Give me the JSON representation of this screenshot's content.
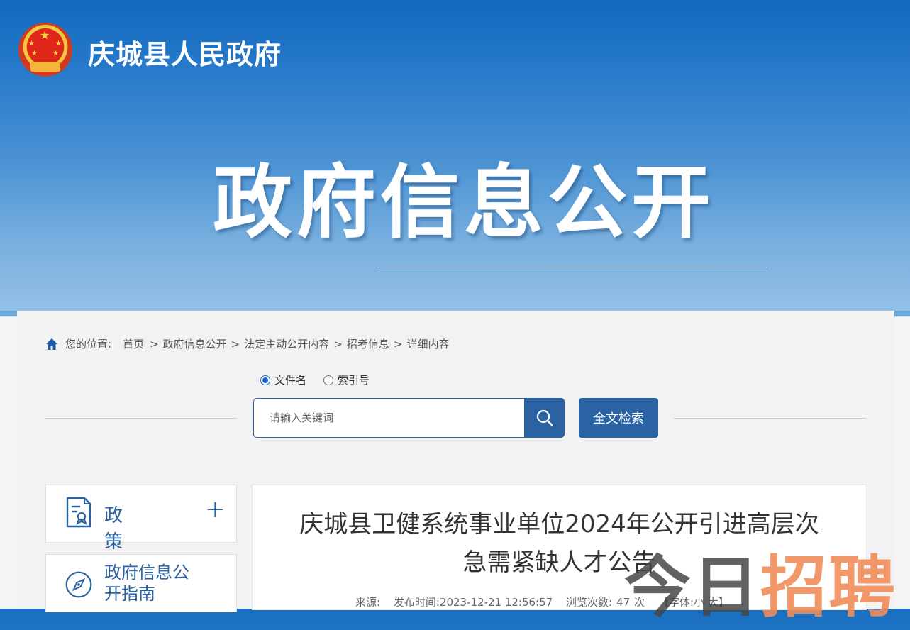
{
  "header": {
    "site_title": "庆城县人民政府",
    "big_title": "政府信息公开"
  },
  "breadcrumb": {
    "prefix": "您的位置:",
    "items": [
      "首页",
      "政府信息公开",
      "法定主动公开内容",
      "招考信息",
      "详细内容"
    ],
    "separator": ">"
  },
  "search": {
    "options": [
      {
        "label": "文件名",
        "selected": true
      },
      {
        "label": "索引号",
        "selected": false
      }
    ],
    "placeholder": "请输入关键词",
    "fulltext_label": "全文检索"
  },
  "sidebar": {
    "policy_label": "政 策",
    "guide_label": "政府信息公开指南"
  },
  "article": {
    "title": "庆城县卫健系统事业单位2024年公开引进高层次急需紧缺人才公告",
    "source_label": "来源:",
    "publish_label": "发布时间:",
    "publish_time": "2023-12-21 12:56:57",
    "views_label": "浏览次数:",
    "views": "47",
    "views_unit": "次",
    "font_size_label": "【字体:小 大】"
  },
  "watermark": {
    "part1": "今日",
    "part2": "招聘"
  },
  "colors": {
    "brand_blue": "#2a62a3",
    "banner_top": "#1168bd",
    "panel_bg": "#f2f2f2"
  }
}
